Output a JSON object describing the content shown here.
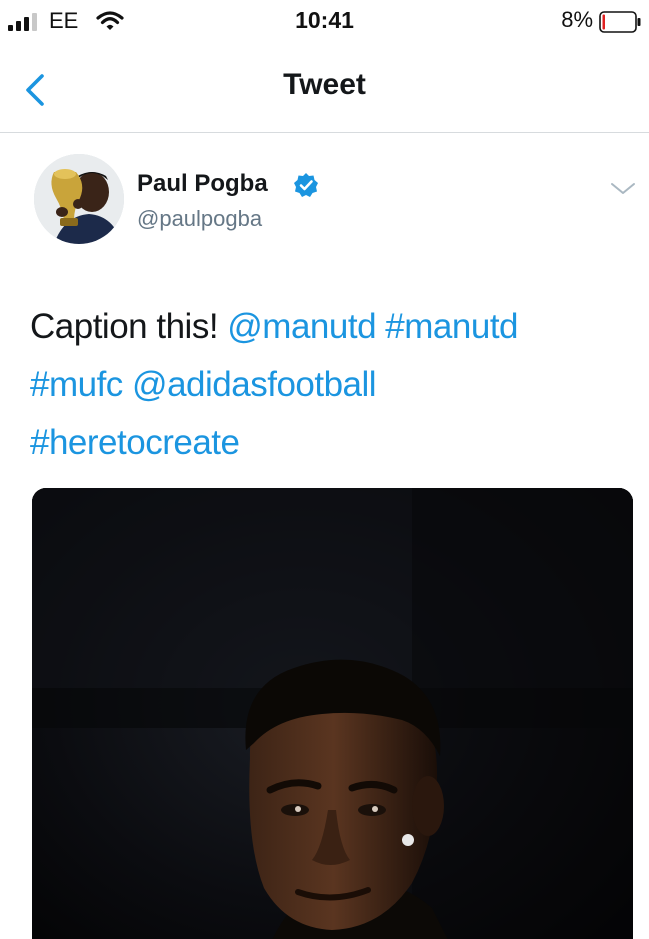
{
  "status_bar": {
    "carrier": "EE",
    "time": "10:41",
    "battery_percent": "8%",
    "battery_level": 0.08,
    "signal_bars_filled": 3,
    "icons": [
      "signal-icon",
      "wifi-icon",
      "battery-icon"
    ]
  },
  "nav": {
    "title": "Tweet",
    "back_icon": "chevron-left-icon"
  },
  "tweet": {
    "author": {
      "name": "Paul Pogba",
      "handle": "@paulpogba",
      "verified": true
    },
    "text": {
      "plain": "Caption this! ",
      "links": [
        "@manutd",
        "#manutd",
        "#mufc",
        "@adidasfootball",
        "#heretocreate"
      ]
    },
    "menu_icon": "chevron-down-icon"
  },
  "colors": {
    "link": "#1b95e0",
    "text": "#14171a",
    "secondary": "#657786",
    "battery_low": "#e02020",
    "divider": "#d7dbde"
  }
}
